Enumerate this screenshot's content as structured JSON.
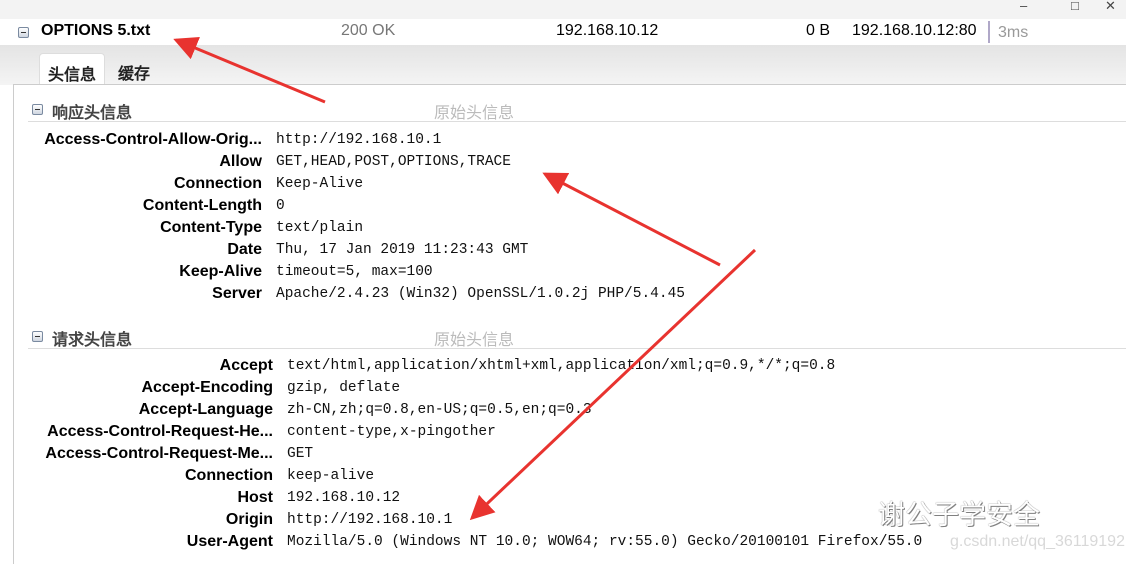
{
  "window": {
    "minimize": "–",
    "maximize": "□",
    "close": "✕"
  },
  "request": {
    "name": "OPTIONS 5.txt",
    "status": "200 OK",
    "host": "192.168.10.12",
    "size": "0 B",
    "remote": "192.168.10.12:80",
    "time": "3ms"
  },
  "tabs": [
    {
      "label": "头信息",
      "active": true
    },
    {
      "label": "缓存",
      "active": false
    }
  ],
  "response_section": {
    "title": "响应头信息",
    "raw_label": "原始头信息",
    "headers": [
      {
        "k": "Access-Control-Allow-Orig...",
        "v": "http://192.168.10.1"
      },
      {
        "k": "Allow",
        "v": "GET,HEAD,POST,OPTIONS,TRACE"
      },
      {
        "k": "Connection",
        "v": "Keep-Alive"
      },
      {
        "k": "Content-Length",
        "v": "0"
      },
      {
        "k": "Content-Type",
        "v": "text/plain"
      },
      {
        "k": "Date",
        "v": "Thu, 17 Jan 2019 11:23:43 GMT"
      },
      {
        "k": "Keep-Alive",
        "v": "timeout=5, max=100"
      },
      {
        "k": "Server",
        "v": "Apache/2.4.23 (Win32) OpenSSL/1.0.2j PHP/5.4.45"
      }
    ]
  },
  "request_section": {
    "title": "请求头信息",
    "raw_label": "原始头信息",
    "headers": [
      {
        "k": "Accept",
        "v": "text/html,application/xhtml+xml,application/xml;q=0.9,*/*;q=0.8"
      },
      {
        "k": "Accept-Encoding",
        "v": "gzip, deflate"
      },
      {
        "k": "Accept-Language",
        "v": "zh-CN,zh;q=0.8,en-US;q=0.5,en;q=0.3"
      },
      {
        "k": "Access-Control-Request-He...",
        "v": "content-type,x-pingother"
      },
      {
        "k": "Access-Control-Request-Me...",
        "v": "GET"
      },
      {
        "k": "Connection",
        "v": "keep-alive"
      },
      {
        "k": "Host",
        "v": "192.168.10.12"
      },
      {
        "k": "Origin",
        "v": "http://192.168.10.1"
      },
      {
        "k": "User-Agent",
        "v": "Mozilla/5.0 (Windows NT 10.0; WOW64; rv:55.0) Gecko/20100101 Firefox/55.0"
      }
    ]
  },
  "watermark": {
    "text": "谢公子学安全",
    "url": "g.csdn.net/qq_36119192"
  },
  "colors": {
    "arrow": "#e8332f"
  }
}
